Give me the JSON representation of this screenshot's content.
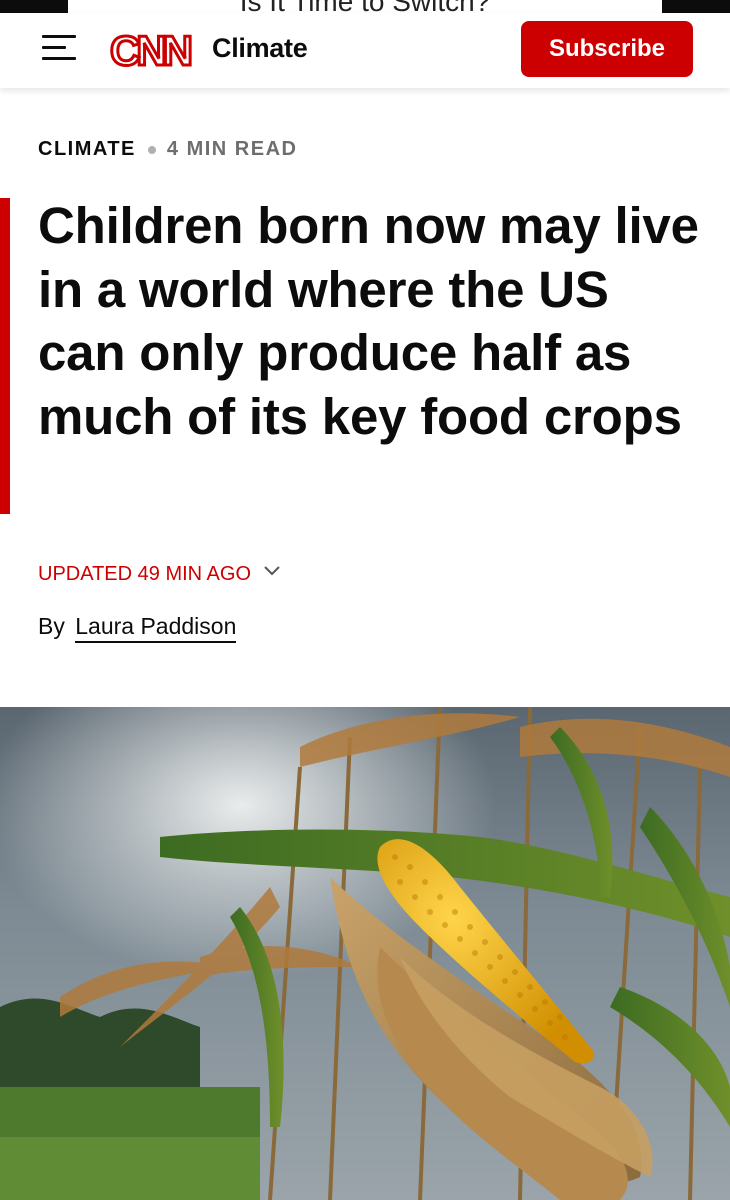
{
  "ad": {
    "text": "Is It Time to Switch?"
  },
  "header": {
    "menu_icon": "hamburger-menu-icon",
    "logo_text": "CNN",
    "section": "Climate",
    "subscribe_label": "Subscribe",
    "brand_color": "#cc0000"
  },
  "article": {
    "category": "CLIMATE",
    "read_time": "4 MIN READ",
    "headline": "Children born now may live in a world where the US can only produce half as much of its key food crops",
    "updated": "UPDATED 49 MIN AGO",
    "updated_icon": "chevron-down-icon",
    "byline_prefix": "By",
    "author": "Laura Paddison"
  },
  "hero_image": {
    "subject": "corn-cob-in-field-photo"
  }
}
